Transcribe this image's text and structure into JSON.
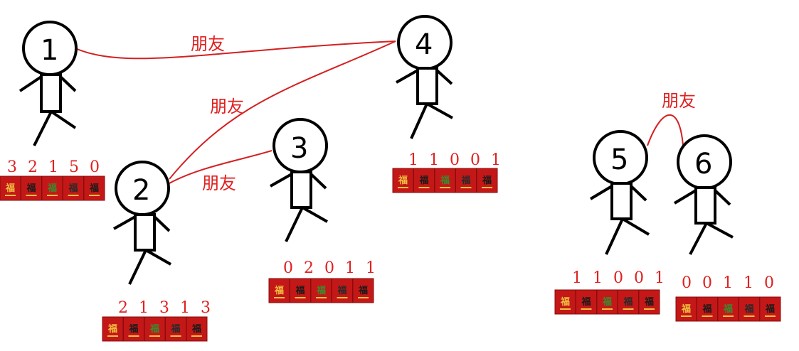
{
  "people": [
    {
      "id": "1",
      "label": "1",
      "digits": "3 2 1 5 0"
    },
    {
      "id": "2",
      "label": "2",
      "digits": "2 1 3 1 3"
    },
    {
      "id": "3",
      "label": "3",
      "digits": "0 2 0 1 1"
    },
    {
      "id": "4",
      "label": "4",
      "digits": "1 1 0 0 1"
    },
    {
      "id": "5",
      "label": "5",
      "digits": "1 1 0 0 1"
    },
    {
      "id": "6",
      "label": "6",
      "digits": "0 0 1 1 0"
    }
  ],
  "edges": [
    {
      "from": "1",
      "to": "4",
      "label": "朋友"
    },
    {
      "from": "2",
      "to": "4",
      "label": "朋友"
    },
    {
      "from": "2",
      "to": "3",
      "label": "朋友"
    },
    {
      "from": "5",
      "to": "6",
      "label": "朋友"
    }
  ],
  "packet_glyph": "福",
  "colors": {
    "edge": "#d42020",
    "text": "#e02020",
    "packet": "#c41818",
    "gold": "#f0c040"
  }
}
